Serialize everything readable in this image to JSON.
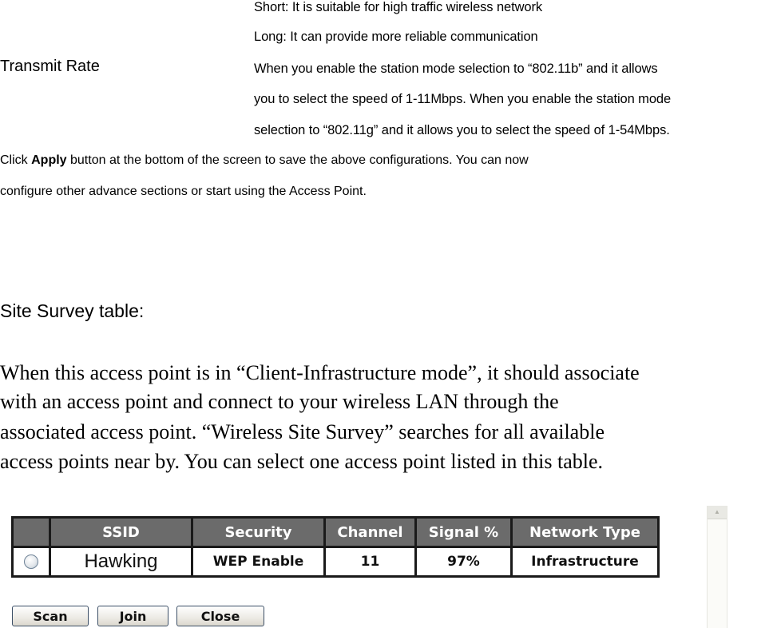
{
  "transmit_rate": {
    "preamble_lines": [
      "Short: It is suitable for high traffic wireless network",
      "Long: It can provide more reliable communication"
    ],
    "term": "Transmit Rate",
    "description_lines": [
      "When you enable the station mode selection to “802.11b” and it allows",
      "you to select the speed of 1-11Mbps. When you enable the station mode",
      "selection to “802.11g” and it allows you to select the speed of 1-54Mbps."
    ]
  },
  "apply_note": {
    "line1_prefix": "Click ",
    "line1_bold": "Apply",
    "line1_suffix": " button at the bottom of the screen to save the above configurations. You can now",
    "line2": "configure other advance sections or start using the Access Point."
  },
  "site_survey": {
    "title": "Site Survey table:",
    "body_lines": [
      "When this access point is in “Client-Infrastructure mode”, it should associate",
      "with an access point and connect to your wireless LAN through the",
      "associated access point. “Wireless Site Survey” searches for all available",
      "access points near by. You can select one access point listed in this table."
    ],
    "table": {
      "columns": [
        "",
        "SSID",
        "Security",
        "Channel",
        "Signal %",
        "Network Type"
      ],
      "rows": [
        {
          "selected": false,
          "ssid": "Hawking",
          "security": "WEP Enable",
          "channel": "11",
          "signal": "97%",
          "network_type": "Infrastructure"
        }
      ]
    },
    "buttons": {
      "scan": "Scan",
      "join": "Join",
      "close": "Close"
    }
  }
}
